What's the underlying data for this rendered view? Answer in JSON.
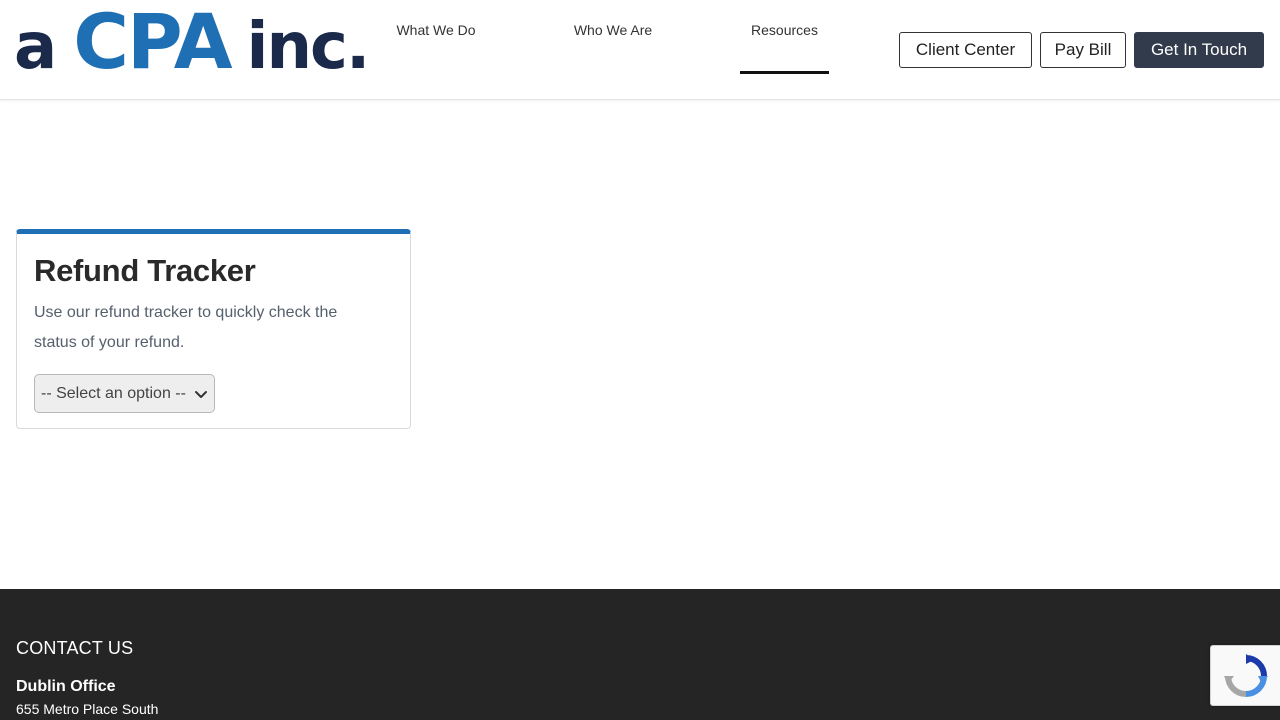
{
  "logo": {
    "a": "a",
    "cpa": "CPA",
    "inc": "inc."
  },
  "nav": {
    "items": [
      {
        "label": "What We Do"
      },
      {
        "label": "Who We Are"
      },
      {
        "label": "Resources"
      }
    ],
    "active": "Resources"
  },
  "header_buttons": {
    "client_center": "Client Center",
    "pay_bill": "Pay Bill",
    "get_in_touch": "Get In Touch"
  },
  "card": {
    "title": "Refund Tracker",
    "description": "Use our refund tracker to quickly check the status of your refund.",
    "select_value": "-- Select an option --"
  },
  "footer": {
    "heading": "CONTACT US",
    "office_name": "Dublin Office",
    "address_line1": "655 Metro Place South"
  },
  "colors": {
    "brand_blue": "#1f6fb5",
    "brand_navy": "#1b2a4a",
    "button_dark": "#313b4c",
    "footer_bg": "#252525"
  },
  "icons": {
    "select_arrow": "chevron-down-icon",
    "recaptcha": "recaptcha-icon"
  }
}
